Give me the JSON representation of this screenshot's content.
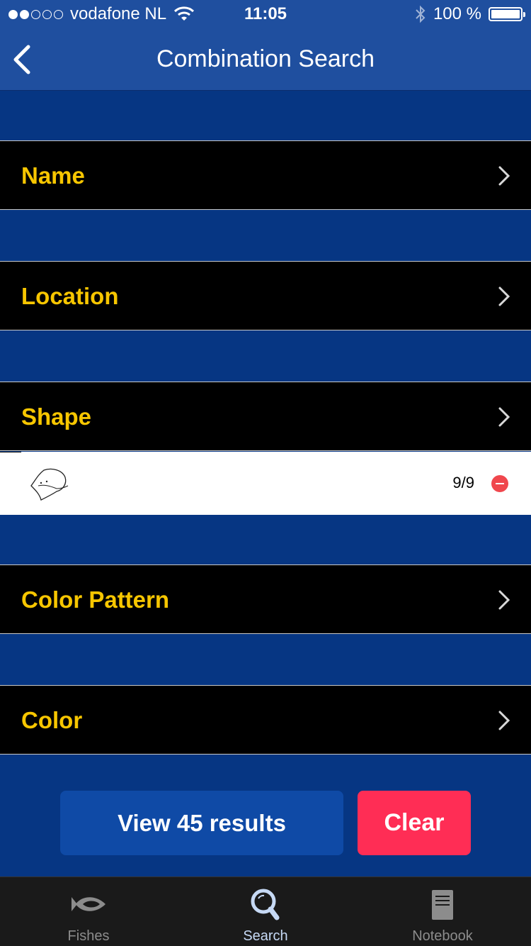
{
  "status_bar": {
    "carrier": "vodafone NL",
    "time": "11:05",
    "battery": "100 %",
    "signal_bars_filled": 2,
    "signal_bars_total": 5
  },
  "nav": {
    "title": "Combination Search",
    "back_icon": "chevron-left-icon"
  },
  "rows": [
    {
      "label": "Name"
    },
    {
      "label": "Location"
    },
    {
      "label": "Shape"
    },
    {
      "label": "Color Pattern"
    },
    {
      "label": "Color"
    }
  ],
  "selected_shape": {
    "count": "9/9",
    "icon": "ray-fish-shape-icon",
    "remove_icon": "minus-circle-icon"
  },
  "actions": {
    "view_results": "View 45 results",
    "clear": "Clear"
  },
  "tabs": [
    {
      "label": "Fishes",
      "icon": "fish-icon",
      "active": false
    },
    {
      "label": "Search",
      "icon": "magnifier-icon",
      "active": true
    },
    {
      "label": "Notebook",
      "icon": "notebook-icon",
      "active": false
    }
  ],
  "colors": {
    "background": "#063683",
    "nav": "#1f4f9f",
    "row_label": "#f7c600",
    "view_button": "#0f4aa6",
    "clear_button": "#ff2d55",
    "remove": "#f0474d"
  }
}
